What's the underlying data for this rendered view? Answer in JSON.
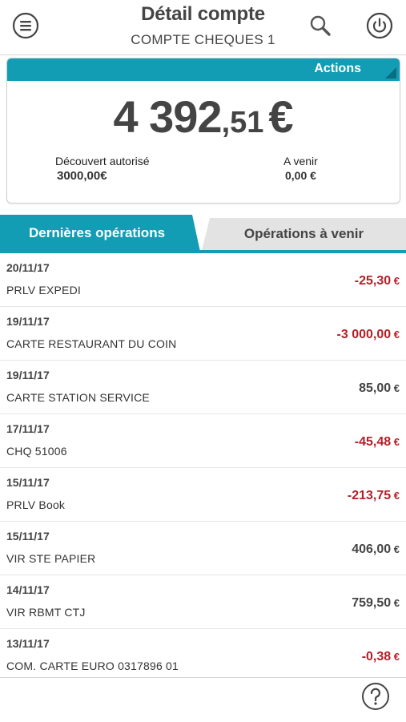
{
  "header": {
    "title": "Détail compte",
    "subtitle": "COMPTE CHEQUES 1",
    "menu_icon": "hamburger-menu-icon",
    "search_icon": "search-icon",
    "power_icon": "power-icon"
  },
  "account": {
    "actions_label": "Actions",
    "balance_int": "4 392",
    "balance_dec": ",51",
    "balance_currency": "€",
    "overdraft_label": "Découvert autorisé",
    "overdraft_value": "3000,00€",
    "upcoming_label": "A venir",
    "upcoming_value": "0,00 €"
  },
  "tabs": [
    {
      "label": "Dernières opérations",
      "active": true
    },
    {
      "label": "Opérations à venir",
      "active": false
    }
  ],
  "operations": [
    {
      "date": "20/11/17",
      "label": "PRLV EXPEDI",
      "amount_main": "-25,30",
      "amount_cur": " €",
      "negative": true
    },
    {
      "date": "19/11/17",
      "label": "CARTE RESTAURANT DU COIN",
      "amount_main": "-3 000,00",
      "amount_cur": " €",
      "negative": true
    },
    {
      "date": "19/11/17",
      "label": "CARTE STATION SERVICE",
      "amount_main": "85,00",
      "amount_cur": " €",
      "negative": false
    },
    {
      "date": "17/11/17",
      "label": "CHQ 51006",
      "amount_main": "-45,48",
      "amount_cur": " €",
      "negative": true
    },
    {
      "date": "15/11/17",
      "label": "PRLV Book",
      "amount_main": "-213,75",
      "amount_cur": " €",
      "negative": true
    },
    {
      "date": "15/11/17",
      "label": "VIR  STE PAPIER",
      "amount_main": "406,00",
      "amount_cur": " €",
      "negative": false
    },
    {
      "date": "14/11/17",
      "label": "VIR  RBMT CTJ",
      "amount_main": "759,50",
      "amount_cur": " €",
      "negative": false
    },
    {
      "date": "13/11/17",
      "label": "COM. CARTE EURO  0317896 01",
      "amount_main": "-0,38",
      "amount_cur": " €",
      "negative": true
    }
  ],
  "footer": {
    "help_icon": "help-icon"
  },
  "colors": {
    "accent": "#129db4",
    "negative": "#b41f26",
    "text": "#444444"
  }
}
